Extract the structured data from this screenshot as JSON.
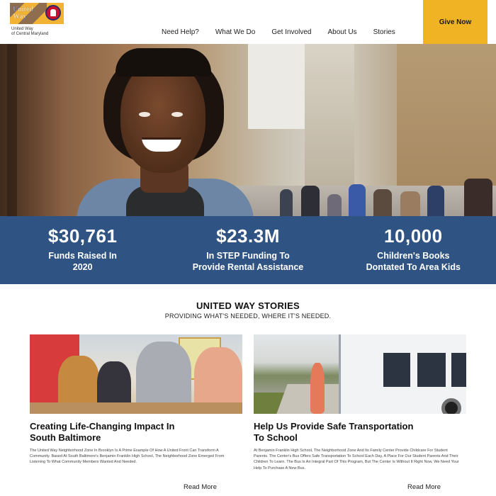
{
  "header": {
    "logo_word": "United Way",
    "logo_lines": [
      "United Way",
      "of Central Maryland"
    ],
    "nav": [
      "Need Help?",
      "What We Do",
      "Get Involved",
      "About Us",
      "Stories"
    ],
    "give_label": "Give Now",
    "accent": "#f0b323"
  },
  "hero": {
    "image": "smiling young man with locs on a city street"
  },
  "stats": [
    {
      "value": "$30,761",
      "label_l1": "Funds Raised In",
      "label_l2": "2020"
    },
    {
      "value": "$23.3M",
      "label_l1": "In STEP Funding To",
      "label_l2": "Provide Rental Assistance"
    },
    {
      "value": "10,000",
      "label_l1": "Children's Books",
      "label_l2": "Dontated To Area Kids"
    }
  ],
  "stats_color": "#2f5382",
  "stories": {
    "title": "UNITED WAY STORIES",
    "subtitle": "PROVIDING WHAT'S NEEDED, WHERE IT'S NEEDED.",
    "cards": [
      {
        "title_l1": "Creating Life-Changing Impact In",
        "title_l2": "South Baltimore",
        "body": "The United Way Neighborhood Zone In Brooklyn Is A Prime Example Of How A United Front Can Transform A Community. Based At South Baltimore's Benjamin Franklin High School, The Neighborhood Zone Emerged From Listening To What Community Members Wanted And Needed.",
        "read_more": "Read More"
      },
      {
        "title_l1": "Help Us Provide Safe Transportation",
        "title_l2": "To School",
        "body": "At Benjamin Franklin High School, The Neighborhood Zone And Its Family Center Provide Childcare For Student Parents. The Center's Bus Offers Safe Transportation To School Each Day, A Place For Our Student Parents And Their Children To Learn. The Bus Is An Integral Part Of This Program, But The Center Is Without It Right Now. We Need Your Help To Purchase A New Bus.",
        "read_more": "Read More"
      }
    ]
  }
}
